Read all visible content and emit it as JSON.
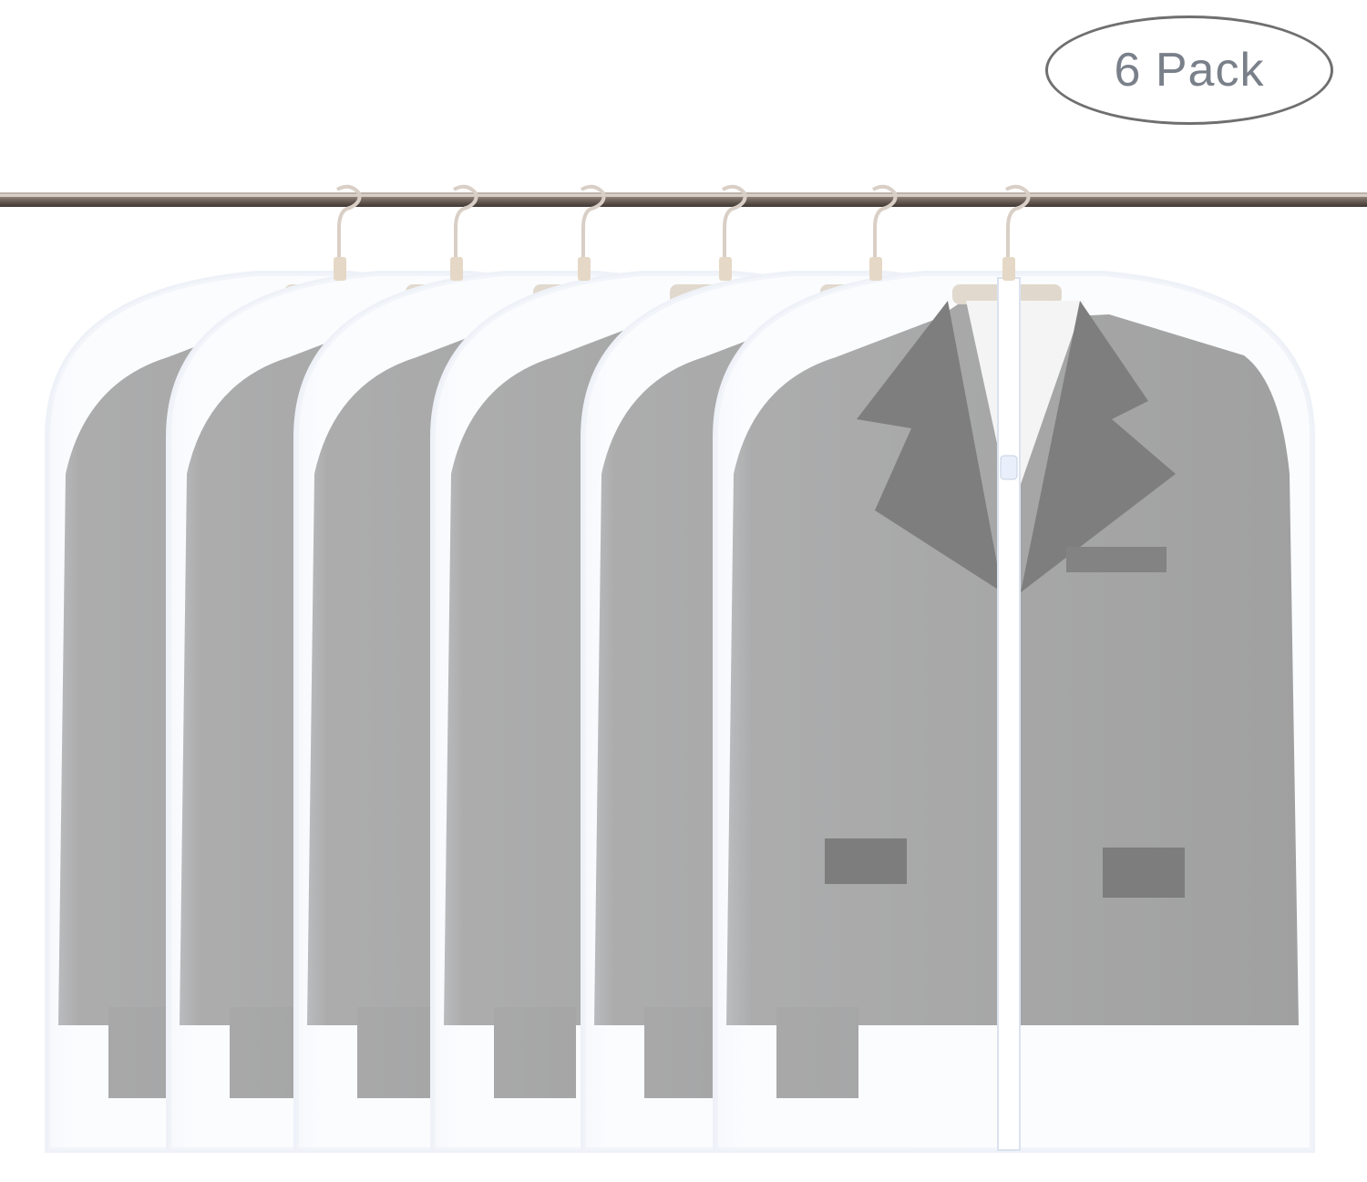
{
  "badge": {
    "label": "6 Pack"
  },
  "product": {
    "item": "garment-bag",
    "count": 6,
    "garment": "suit-jacket"
  },
  "colors": {
    "background": "#ffffff",
    "jacket": "#8a8a8a",
    "bag_edge": "#eef2f8",
    "rod": "#8a7d73",
    "badge_border": "#6f6f6f",
    "badge_text": "#7a808a"
  }
}
